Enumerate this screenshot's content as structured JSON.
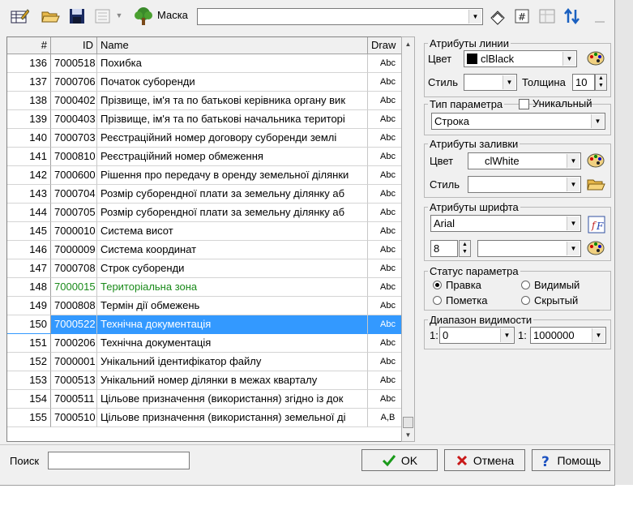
{
  "toolbar": {
    "mask_label": "Маска",
    "mask_value": ""
  },
  "grid": {
    "headers": {
      "num": "#",
      "id": "ID",
      "name": "Name",
      "draw": "Draw"
    },
    "rows": [
      {
        "num": "136",
        "id": "7000518",
        "name": "Похибка",
        "draw": "Abc"
      },
      {
        "num": "137",
        "id": "7000706",
        "name": "Початок суборенди",
        "draw": "Abc"
      },
      {
        "num": "138",
        "id": "7000402",
        "name": "Прізвище, ім'я та по батькові керівника органу вик",
        "draw": "Abc"
      },
      {
        "num": "139",
        "id": "7000403",
        "name": "Прізвище, ім'я та по батькові начальника територі",
        "draw": "Abc"
      },
      {
        "num": "140",
        "id": "7000703",
        "name": "Реєстраційний номер договору суборенди землі",
        "draw": "Abc"
      },
      {
        "num": "141",
        "id": "7000810",
        "name": "Реєстраційний номер обмеження",
        "draw": "Abc"
      },
      {
        "num": "142",
        "id": "7000600",
        "name": "Рішення про передачу в оренду земельної ділянки",
        "draw": "Abc"
      },
      {
        "num": "143",
        "id": "7000704",
        "name": "Розмір суборендної плати за земельну ділянку аб",
        "draw": "Abc"
      },
      {
        "num": "144",
        "id": "7000705",
        "name": "Розмір суборендної плати за земельну ділянку аб",
        "draw": "Abc"
      },
      {
        "num": "145",
        "id": "7000010",
        "name": "Система висот",
        "draw": "Abc"
      },
      {
        "num": "146",
        "id": "7000009",
        "name": "Система координат",
        "draw": "Abc"
      },
      {
        "num": "147",
        "id": "7000708",
        "name": "Строк суборенди",
        "draw": "Abc"
      },
      {
        "num": "148",
        "id": "7000015",
        "name": "Територіальна зона",
        "draw": "Abc",
        "style": "green"
      },
      {
        "num": "149",
        "id": "7000808",
        "name": "Термін дії обмежень",
        "draw": "Abc"
      },
      {
        "num": "150",
        "id": "7000522",
        "name": "Технічна документація",
        "draw": "Abc",
        "style": "sel"
      },
      {
        "num": "151",
        "id": "7000206",
        "name": "Технічна документація",
        "draw": "Abc"
      },
      {
        "num": "152",
        "id": "7000001",
        "name": "Унікальний ідентифікатор файлу",
        "draw": "Abc"
      },
      {
        "num": "153",
        "id": "7000513",
        "name": "Унікальний номер ділянки в межах кварталу",
        "draw": "Abc"
      },
      {
        "num": "154",
        "id": "7000511",
        "name": "Цільове призначення (використання) згідно із док",
        "draw": "Abc"
      },
      {
        "num": "155",
        "id": "7000510",
        "name": "Цільове призначення (використання) земельної ді",
        "draw": "A,B"
      }
    ]
  },
  "line_attrs": {
    "title": "Атрибуты линии",
    "color_label": "Цвет",
    "color_value": "clBlack",
    "style_label": "Стиль",
    "style_value": "",
    "width_label": "Толщина",
    "width_value": "10"
  },
  "param_type": {
    "title": "Тип параметра",
    "unique_label": "Уникальный",
    "unique_checked": false,
    "value": "Строка"
  },
  "fill_attrs": {
    "title": "Атрибуты заливки",
    "color_label": "Цвет",
    "color_value": "clWhite",
    "style_label": "Стиль",
    "style_value": ""
  },
  "font_attrs": {
    "title": "Атрибуты шрифта",
    "font_value": "Arial",
    "size_value": "8",
    "extra_value": ""
  },
  "param_status": {
    "title": "Статус параметра",
    "options": [
      {
        "label": "Правка",
        "checked": true
      },
      {
        "label": "Видимый",
        "checked": false
      },
      {
        "label": "Пометка",
        "checked": false
      },
      {
        "label": "Скрытый",
        "checked": false
      }
    ]
  },
  "visibility": {
    "title": "Диапазон видимости",
    "from_prefix": "1:",
    "from_value": "0",
    "to_prefix": "1:",
    "to_value": "1000000"
  },
  "bottom": {
    "search_label": "Поиск",
    "search_value": "",
    "ok_label": "OK",
    "cancel_label": "Отмена",
    "help_label": "Помощь"
  },
  "colors": {
    "selection": "#3399ff",
    "green_row": "#1a8a1a"
  }
}
